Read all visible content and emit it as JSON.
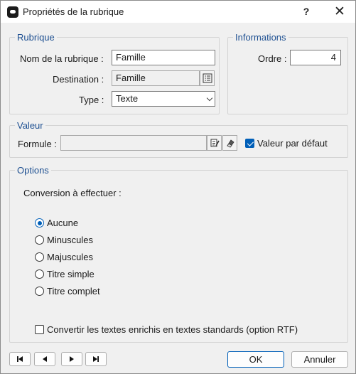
{
  "window": {
    "title": "Propriétés de la rubrique",
    "help_glyph": "?",
    "close_glyph": "✕"
  },
  "rubrique": {
    "legend": "Rubrique",
    "name_label": "Nom de la rubrique :",
    "name_value": "Famille",
    "destination_label": "Destination :",
    "destination_value": "Famille",
    "type_label": "Type :",
    "type_value": "Texte"
  },
  "informations": {
    "legend": "Informations",
    "order_label": "Ordre :",
    "order_value": "4"
  },
  "valeur": {
    "legend": "Valeur",
    "formula_label": "Formule :",
    "formula_value": "",
    "default_label": "Valeur par défaut",
    "default_checked": true
  },
  "options": {
    "legend": "Options",
    "conversion_label": "Conversion à effectuer :",
    "radios": [
      {
        "label": "Aucune",
        "checked": true
      },
      {
        "label": "Minuscules",
        "checked": false
      },
      {
        "label": "Majuscules",
        "checked": false
      },
      {
        "label": "Titre simple",
        "checked": false
      },
      {
        "label": "Titre complet",
        "checked": false
      }
    ],
    "rtf_label": "Convertir les textes enrichis en textes standards (option RTF)",
    "rtf_checked": false
  },
  "footer": {
    "ok_label": "OK",
    "cancel_label": "Annuler"
  },
  "icons": {
    "app": "app-icon",
    "list": "list-icon",
    "edit": "edit-list-icon",
    "eraser": "eraser-icon",
    "first": "first-record-icon",
    "prev": "previous-record-icon",
    "next": "next-record-icon",
    "last": "last-record-icon"
  },
  "colors": {
    "accent": "#005fb8",
    "legend": "#1d4f91"
  }
}
